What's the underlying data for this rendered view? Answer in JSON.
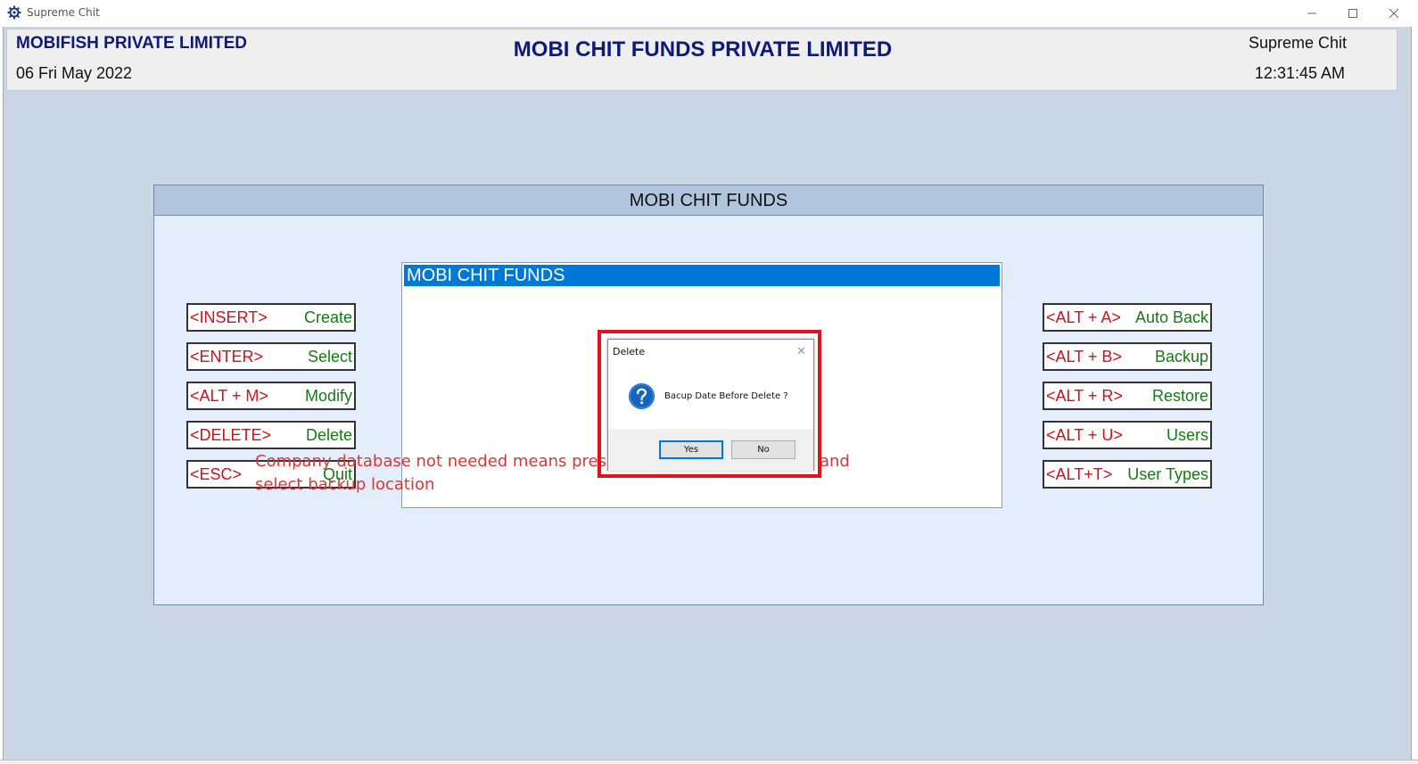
{
  "window": {
    "title": "Supreme Chit"
  },
  "header": {
    "company": "MOBIFISH PRIVATE LIMITED",
    "date": "06 Fri May 2022",
    "main_title": "MOBI CHIT FUNDS PRIVATE LIMITED",
    "app_name": "Supreme Chit",
    "time": "12:31:45 AM"
  },
  "panel": {
    "title": "MOBI CHIT FUNDS",
    "left_buttons": [
      {
        "key": "<INSERT>",
        "action": "Create"
      },
      {
        "key": "<ENTER>",
        "action": "Select"
      },
      {
        "key": "<ALT + M>",
        "action": "Modify"
      },
      {
        "key": "<DELETE>",
        "action": "Delete"
      },
      {
        "key": "<ESC>",
        "action": "Quit"
      }
    ],
    "right_buttons": [
      {
        "key": "<ALT + A>",
        "action": "Auto Back"
      },
      {
        "key": "<ALT + B>",
        "action": "Backup"
      },
      {
        "key": "<ALT + R>",
        "action": "Restore"
      },
      {
        "key": "<ALT + U>",
        "action": "Users"
      },
      {
        "key": "<ALT+T>",
        "action": "User Types"
      }
    ]
  },
  "inner_window": {
    "title": "MOBI CHIT FUNDS"
  },
  "dialog": {
    "title": "Delete",
    "message": "Bacup Date Before Delete ?",
    "yes_label": "Yes",
    "no_label": "No"
  },
  "annotation": {
    "text": "Company database not needed means press no button otherwise yes and select backup location"
  },
  "colors": {
    "key_text": "#d0101a",
    "action_text": "#157a15",
    "title_blue": "#0d1a78",
    "highlight_red": "#e0121b"
  }
}
